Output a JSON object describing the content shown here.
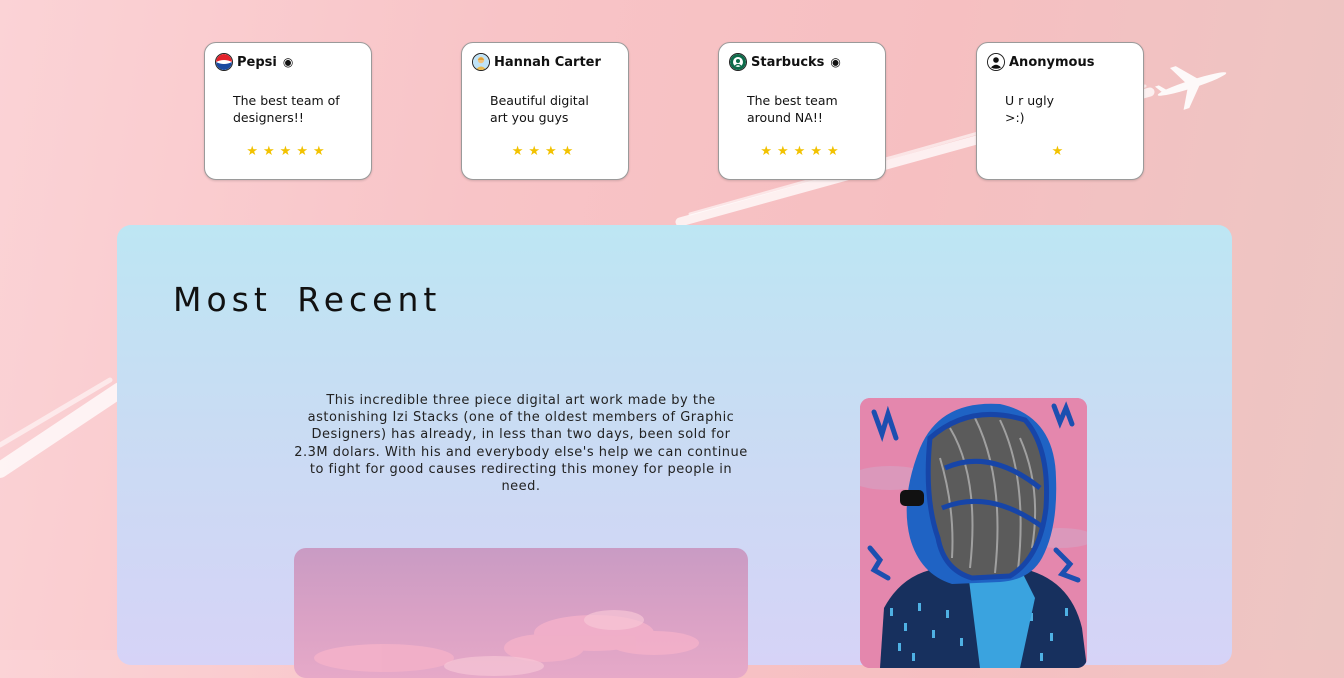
{
  "reviews": [
    {
      "name": "Pepsi",
      "verified_mark": "◉",
      "text": "The best team of designers!!",
      "rating": 5,
      "stars": "★★★★★",
      "avatar_icon": "pepsi-logo-icon"
    },
    {
      "name": "Hannah Carter",
      "verified_mark": "",
      "text": "Beautiful digital art you guys",
      "rating": 4,
      "stars": "★★★★",
      "avatar_icon": "user-avatar-icon"
    },
    {
      "name": "Starbucks",
      "verified_mark": "◉",
      "text": "The best team around NA!!",
      "rating": 5,
      "stars": "★★★★★",
      "avatar_icon": "starbucks-logo-icon"
    },
    {
      "name": "Anonymous",
      "verified_mark": "",
      "text": "U r ugly >:)",
      "rating": 1,
      "stars": "★",
      "avatar_icon": "anonymous-user-icon"
    }
  ],
  "most_recent": {
    "title": "Most Recent",
    "description": "This incredible three piece digital art work made by the astonishing Izi Stacks (one of the oldest members of Graphic Designers) has already, in less than two days, been sold for 2.3M dolars. With his and everybody else's help we can continue to fight for good causes redirecting this money for people in need."
  },
  "colors": {
    "star": "#f2c200",
    "panel_top": "#bde6f3",
    "panel_bottom": "#d6d3f7",
    "page_background": "#f8c4c7"
  }
}
